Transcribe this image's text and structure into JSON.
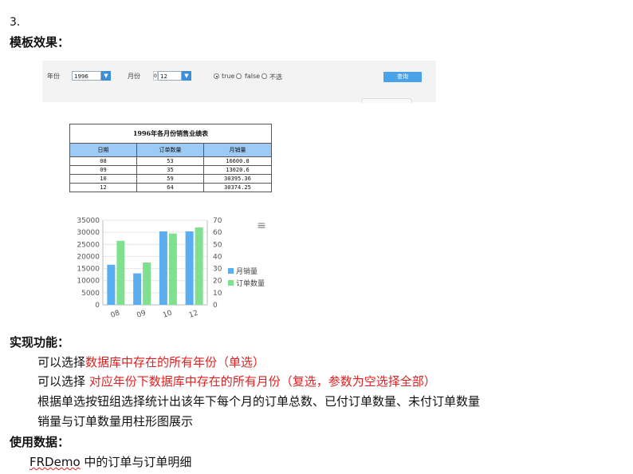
{
  "doc": {
    "number": "3.",
    "heading_template": "模板效果：",
    "heading_func": "实现功能：",
    "func_lines": [
      {
        "plain": "可以选择",
        "red": "数据库中存在的所有年份（单选）"
      },
      {
        "plain": "可以选择 ",
        "red": "对应年份下数据库中存在的所有月份（复选，参数为空选择全部）"
      },
      {
        "plain": "根据单选按钮组选择统计出该年下每个月的订单总数、已付订单数量、未付订单数量",
        "red": ""
      },
      {
        "plain": "销量与订单数量用柱形图展示",
        "red": ""
      }
    ],
    "heading_data": "使用数据：",
    "data_line_a": "FRDemo",
    "data_line_b": " 中的订单与订单明细"
  },
  "params": {
    "year_label": "年份",
    "year_value": "1996",
    "month_label": "月份",
    "month_value": "12",
    "month_prefix": "0",
    "radios": [
      {
        "label": "true",
        "checked": true
      },
      {
        "label": "false",
        "checked": false
      },
      {
        "label": "不选",
        "checked": false
      }
    ],
    "query_label": "查询",
    "dropdown_glyph": "▼"
  },
  "report": {
    "title": "1996年各月份销售业绩表",
    "headers": [
      "日期",
      "订单数量",
      "月销量"
    ],
    "rows": [
      [
        "08",
        "53",
        "16600.8"
      ],
      [
        "09",
        "35",
        "13020.6"
      ],
      [
        "10",
        "59",
        "30395.36"
      ],
      [
        "12",
        "64",
        "30374.25"
      ]
    ]
  },
  "chart_data": {
    "type": "bar",
    "categories": [
      "08",
      "09",
      "10",
      "12"
    ],
    "series": [
      {
        "name": "月销量",
        "axis": "left",
        "color": "#5aaef0",
        "values": [
          16600.8,
          13020.6,
          30395.36,
          30374.25
        ]
      },
      {
        "name": "订单数量",
        "axis": "right",
        "color": "#7fe08f",
        "values": [
          53,
          35,
          59,
          64
        ]
      }
    ],
    "y_left": {
      "min": 0,
      "max": 35000,
      "ticks": [
        "35000",
        "30000",
        "25000",
        "20000",
        "15000",
        "10000",
        "5000",
        "0"
      ]
    },
    "y_right": {
      "min": 0,
      "max": 70,
      "ticks": [
        "70",
        "60",
        "50",
        "40",
        "30",
        "20",
        "10",
        "0"
      ]
    },
    "menu_glyph": "≡",
    "legend_position": "right"
  }
}
